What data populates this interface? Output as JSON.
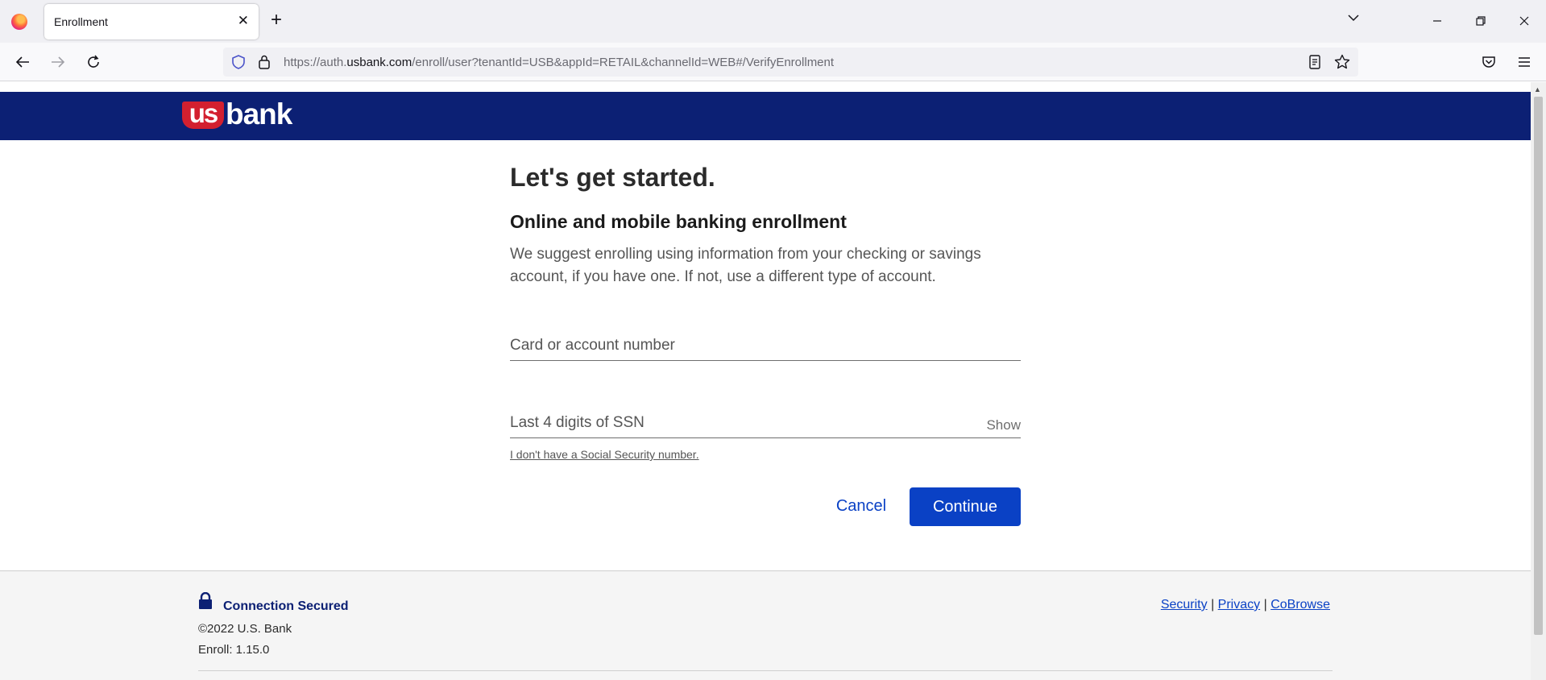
{
  "browser": {
    "tab_title": "Enrollment",
    "url_prefix": "https://auth.",
    "url_domain": "usbank.com",
    "url_path": "/enroll/user?tenantId=USB&appId=RETAIL&channelId=WEB#/VerifyEnrollment"
  },
  "brand": {
    "logo_us": "us",
    "logo_bank": "bank",
    "header_color": "#0c2074",
    "logo_red": "#d3202f",
    "accent": "#0a41c5"
  },
  "main": {
    "title": "Let's get started.",
    "subtitle": "Online and mobile banking enrollment",
    "intro": "We suggest enrolling using information from your checking or savings account, if you have one. If not, use a different type of account.",
    "card_placeholder": "Card or account number",
    "card_value": "",
    "ssn_placeholder": "Last 4 digits of SSN",
    "ssn_value": "",
    "show_label": "Show",
    "no_ssn_link": "I don't have a Social Security number.",
    "cancel_label": "Cancel",
    "continue_label": "Continue"
  },
  "footer": {
    "secured": "Connection Secured",
    "copyright": "©2022 U.S. Bank",
    "version": "Enroll: 1.15.0",
    "links": [
      "Security",
      "Privacy",
      "CoBrowse"
    ],
    "separator": "|"
  }
}
